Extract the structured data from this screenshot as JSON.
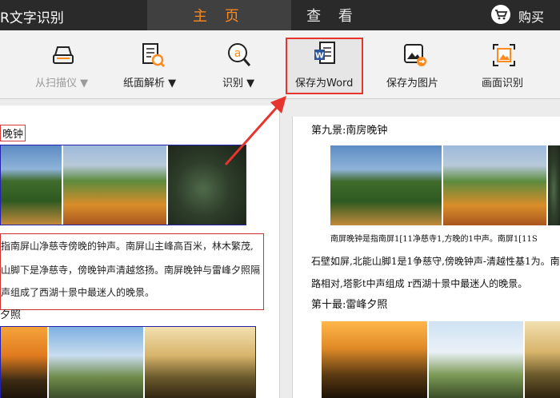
{
  "topbar": {
    "app_title": "R文字识别",
    "tabs": [
      "主 页",
      "查 看"
    ],
    "buy_label": "购买"
  },
  "toolbar": {
    "scanner": "从扫描仪 ▼",
    "paper_analysis": "纸面解析 ▼",
    "recognize": "识别 ▼",
    "save_word": "保存为Word",
    "save_image": "保存为图片",
    "screen_recognize": "画面识别"
  },
  "left_page": {
    "heading_fragment": "晚钟",
    "lines": [
      "指南屏山净慈寺傍晚的钟声。南屏山主峰高百米，林木繁茂,",
      "山脚下是净慈寺，傍晚钟声清越悠扬。南屏晚钟与雷峰夕照隔",
      "声组成了西湖十景中最迷人的晚景。"
    ],
    "next_heading_fragment": "夕照"
  },
  "right_page": {
    "heading_9": "第九景:南房晚钟",
    "caption": "南屏晚钟是指南屏1[11净慈寺1,方晚的1中声。南屏1[11S",
    "lines": [
      "石壁如屏,北能山脚1是1争慈守,傍晚钟声-清越性基1为。南",
      "路相对,塔影t中声组成 r西湖十景中最迷人的晚景。"
    ],
    "heading_10": "第十最:雷峰夕照"
  },
  "colors": {
    "topbar_bg": "#2a2a2a",
    "active_tab_text": "#ff8a1e",
    "highlight_border": "#e8342f",
    "arrow": "#e8342f"
  }
}
